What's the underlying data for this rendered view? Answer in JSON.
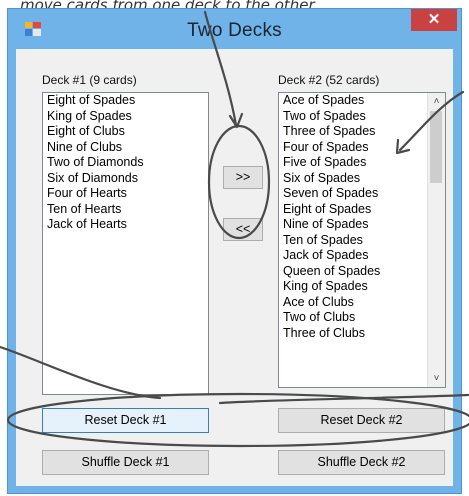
{
  "caption": "move cards from one deck to the other.",
  "window": {
    "title": "Two Decks",
    "close_glyph": "✕"
  },
  "deck1": {
    "label": "Deck #1 (9 cards)",
    "items": [
      "Eight of Spades",
      "King of Spades",
      "Eight of Clubs",
      "Nine of Clubs",
      "Two of Diamonds",
      "Six of Diamonds",
      "Four of Hearts",
      "Ten of Hearts",
      "Jack of Hearts"
    ]
  },
  "deck2": {
    "label": "Deck #2 (52 cards)",
    "items": [
      "Ace of Spades",
      "Two of Spades",
      "Three of Spades",
      "Four of Spades",
      "Five of Spades",
      "Six of Spades",
      "Seven of Spades",
      "Eight of Spades",
      "Nine of Spades",
      "Ten of Spades",
      "Jack of Spades",
      "Queen of Spades",
      "King of Spades",
      "Ace of Clubs",
      "Two of Clubs",
      "Three of Clubs"
    ]
  },
  "buttons": {
    "move_right": ">>",
    "move_left": "<<",
    "reset1": "Reset Deck #1",
    "reset2": "Reset Deck #2",
    "shuffle1": "Shuffle Deck #1",
    "shuffle2": "Shuffle Deck #2"
  },
  "scroll": {
    "up": "˄",
    "down": "˅"
  },
  "colors": {
    "title_bar": "#6fb3e8",
    "close": "#c94141",
    "annotation": "#4a4a4a"
  }
}
